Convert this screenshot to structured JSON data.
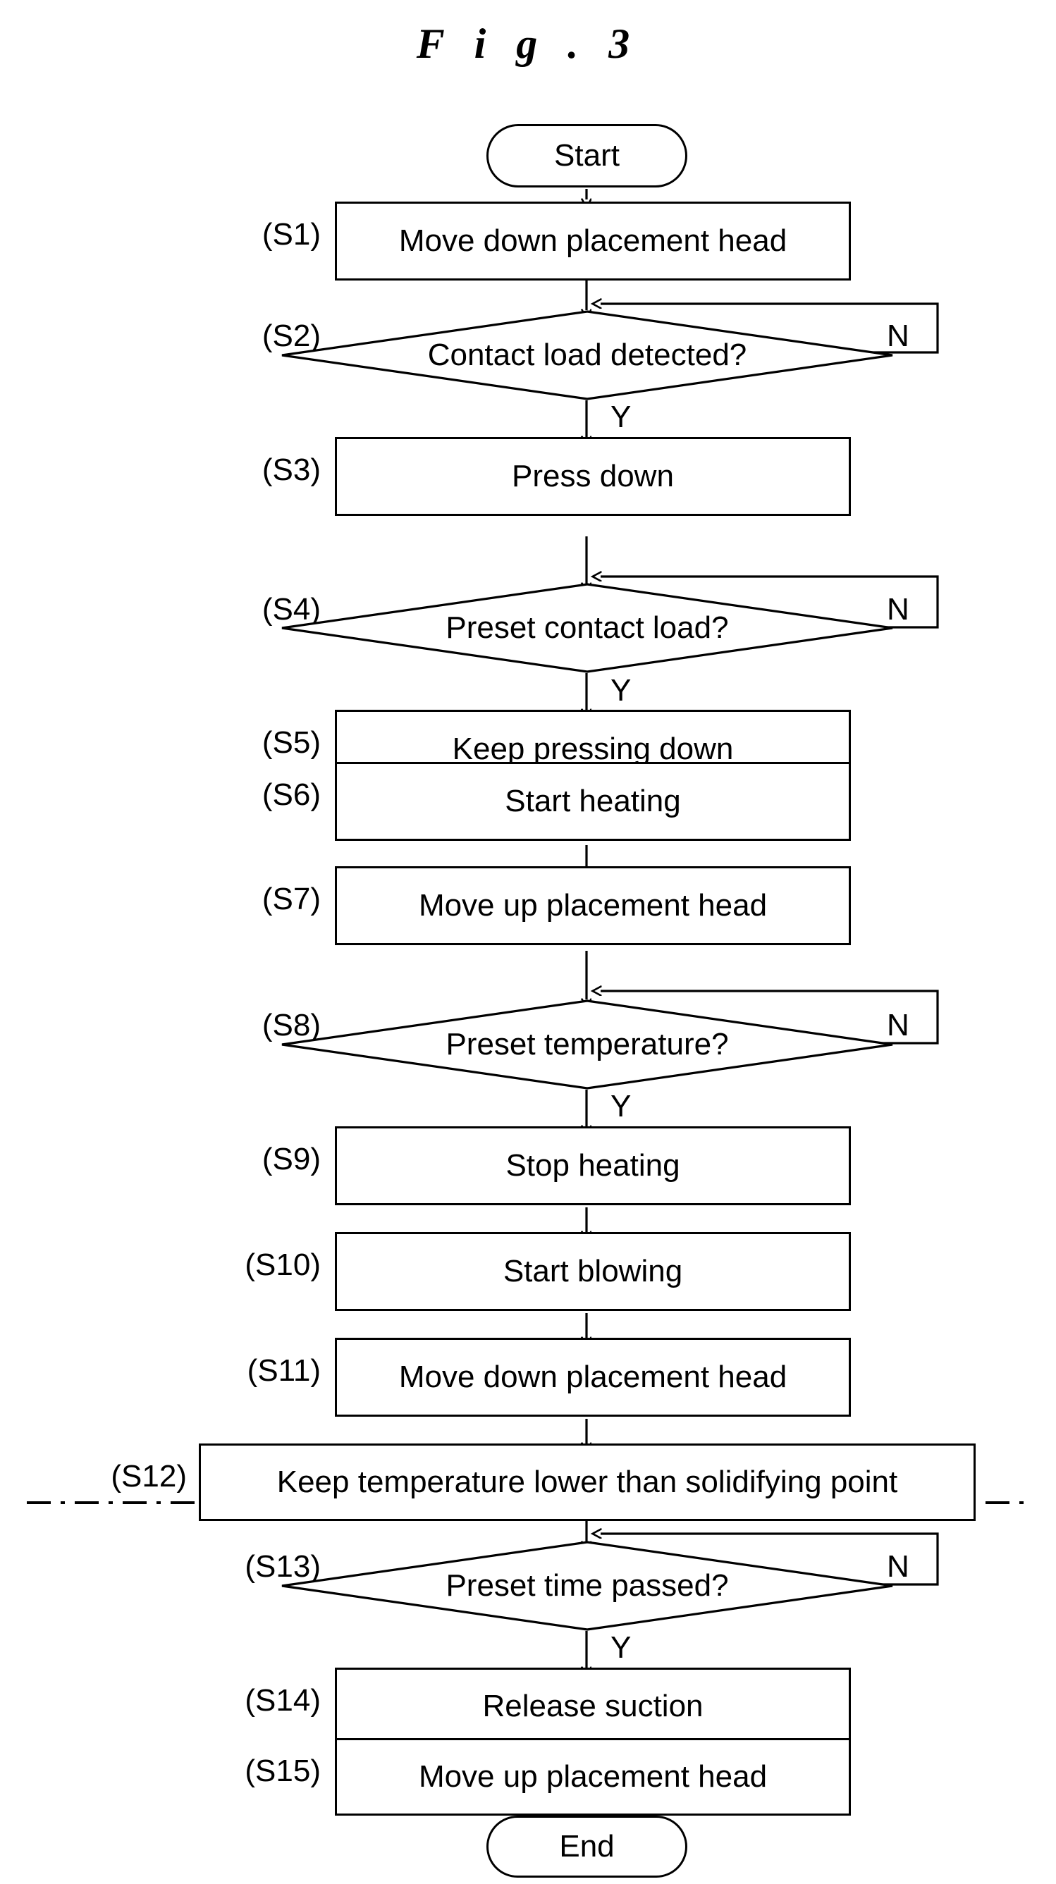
{
  "figure": {
    "title": "F i g . 3",
    "title_plain": "Fig. 3"
  },
  "colors": {
    "stroke": "#000000",
    "background": "#ffffff",
    "text": "#000000"
  },
  "nodes": {
    "start": {
      "id": "start",
      "shape": "terminator",
      "label": "Start"
    },
    "end": {
      "id": "end",
      "shape": "terminator",
      "label": "End"
    },
    "s1": {
      "tag": "(S1)",
      "shape": "process",
      "label": "Move down placement head"
    },
    "s2": {
      "tag": "(S2)",
      "shape": "decision",
      "label": "Contact load detected?"
    },
    "s3": {
      "tag": "(S3)",
      "shape": "process",
      "label": "Press down"
    },
    "s4": {
      "tag": "(S4)",
      "shape": "decision",
      "label": "Preset contact load?"
    },
    "s5": {
      "tag": "(S5)",
      "shape": "process",
      "label": "Keep pressing down"
    },
    "s6": {
      "tag": "(S6)",
      "shape": "process",
      "label": "Start heating"
    },
    "s7": {
      "tag": "(S7)",
      "shape": "process",
      "label": "Move up placement head"
    },
    "s8": {
      "tag": "(S8)",
      "shape": "decision",
      "label": "Preset temperature?"
    },
    "s9": {
      "tag": "(S9)",
      "shape": "process",
      "label": "Stop heating"
    },
    "s10": {
      "tag": "(S10)",
      "shape": "process",
      "label": "Start blowing"
    },
    "s11": {
      "tag": "(S11)",
      "shape": "process",
      "label": "Move down placement head"
    },
    "s12": {
      "tag": "(S12)",
      "shape": "process",
      "label": "Keep temperature lower than solidifying point"
    },
    "s13": {
      "tag": "(S13)",
      "shape": "decision",
      "label": "Preset time passed?"
    },
    "s14": {
      "tag": "(S14)",
      "shape": "process",
      "label": "Release suction"
    },
    "s15": {
      "tag": "(S15)",
      "shape": "process",
      "label": "Move up placement head"
    }
  },
  "branch_labels": {
    "s2_yes": "Y",
    "s2_no": "N",
    "s4_yes": "Y",
    "s4_no": "N",
    "s8_yes": "Y",
    "s8_no": "N",
    "s13_yes": "Y",
    "s13_no": "N"
  },
  "flow": {
    "sequence": [
      "start",
      "s1",
      "s2",
      "s3",
      "s4",
      "s5",
      "s6",
      "s7",
      "s8",
      "s9",
      "s10",
      "s11",
      "s12",
      "s13",
      "s14",
      "s15",
      "end"
    ],
    "loops": [
      {
        "from": "s2",
        "branch": "N",
        "to": "s2",
        "note": "retry contact load detection"
      },
      {
        "from": "s4",
        "branch": "N",
        "to": "s4",
        "note": "retry preset contact load"
      },
      {
        "from": "s8",
        "branch": "N",
        "to": "s8",
        "note": "retry preset temperature"
      },
      {
        "from": "s13",
        "branch": "N",
        "to": "s13",
        "note": "retry preset time passed"
      }
    ],
    "separator": {
      "style": "dash-dot",
      "note": "horizontal dash-dot divider between (S12) and (S13)"
    }
  }
}
